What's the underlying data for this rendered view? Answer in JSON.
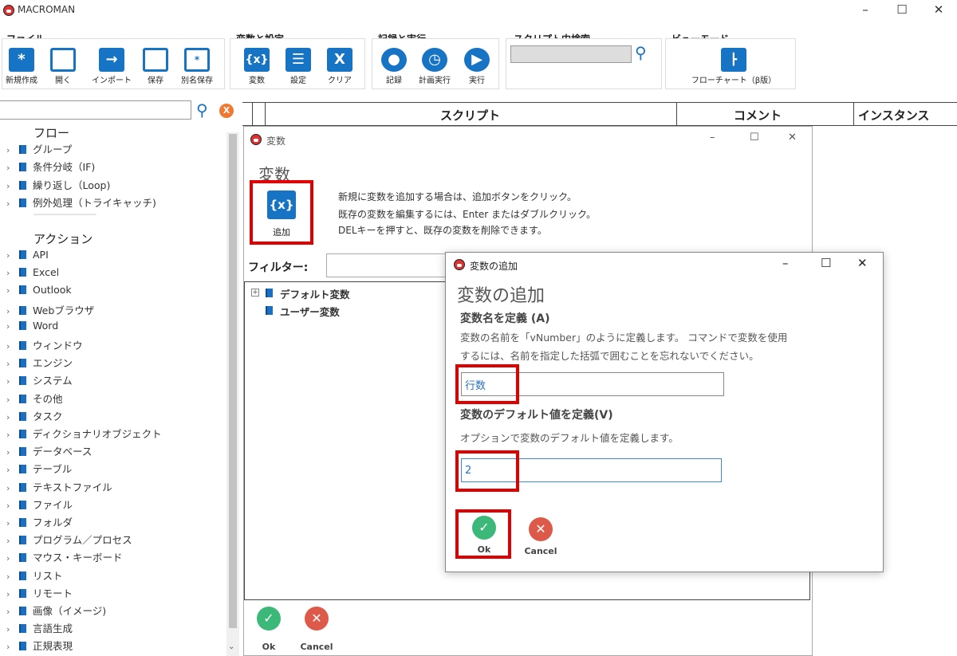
{
  "app": {
    "title": "MACROMAN"
  },
  "ribbon": {
    "file": {
      "title": "ファイル",
      "new": "新規作成",
      "open": "開く",
      "import": "インポート",
      "save": "保存",
      "save_as": "別名保存"
    },
    "vars": {
      "title": "変数と設定",
      "variables": "変数",
      "settings": "設定",
      "clear": "クリア"
    },
    "record": {
      "title": "記録と実行",
      "record": "記録",
      "schedule": "計画実行",
      "run": "実行"
    },
    "search": {
      "title": "スクリプト内検索",
      "placeholder": ""
    },
    "view": {
      "title": "ビューモード",
      "flowchart": "フローチャート（β版）"
    }
  },
  "sidebar": {
    "flow_heading": "フロー",
    "flow_items": [
      "グループ",
      "条件分岐（IF)",
      "繰り返し（Loop)",
      "例外処理（トライキャッチ)"
    ],
    "divider": "------------------------------",
    "action_heading": "アクション",
    "action_items": [
      "API",
      "Excel",
      "Outlook",
      "Webブラウザ",
      "Word",
      "ウィンドウ",
      "エンジン",
      "システム",
      "その他",
      "タスク",
      "ディクショナリオブジェクト",
      "データベース",
      "テーブル",
      "テキストファイル",
      "ファイル",
      "フォルダ",
      "プログラム／プロセス",
      "マウス・キーボード",
      "リスト",
      "リモート",
      "画像（イメージ)",
      "言語生成",
      "正規表現"
    ]
  },
  "grid": {
    "col_script": "スクリプト",
    "col_comment": "コメント",
    "col_instance": "インスタンス"
  },
  "var_dialog": {
    "window_title": "変数",
    "heading": "変数",
    "add_label": "追加",
    "hint1": "新規に変数を追加する場合は、追加ボタンをクリック。",
    "hint2": "既存の変数を編集するには、Enter またはダブルクリック。",
    "hint3": "DELキーを押すと、既存の変数を削除できます。",
    "filter_label": "フィルター:",
    "filter_value": "",
    "tree": [
      "デフォルト変数",
      "ユーザー変数"
    ],
    "ok": "Ok",
    "cancel": "Cancel"
  },
  "add_dialog": {
    "window_title": "変数の追加",
    "heading": "変数の追加",
    "name_label": "変数名を定義 (A)",
    "name_desc1": "変数の名前を「vNumber」のように定義します。 コマンドで変数を使用",
    "name_desc2": "するには、名前を指定した括弧で囲むことを忘れないでください。",
    "name_value": "行数",
    "default_label": "変数のデフォルト値を定義(V)",
    "default_desc": "オプションで変数のデフォルト値を定義します。",
    "default_value": "2",
    "ok": "Ok",
    "cancel": "Cancel"
  },
  "colors": {
    "accent": "#1773c4",
    "highlight": "#e00000",
    "ok": "#3cb878",
    "cancel": "#dd5a4a",
    "clear_badge": "#f07830"
  }
}
